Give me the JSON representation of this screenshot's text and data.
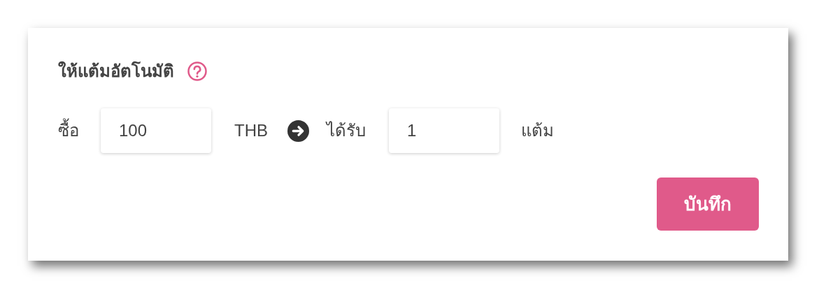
{
  "title": "ให้แต้มอัตโนมัติ",
  "rule": {
    "buy_label": "ซื้อ",
    "amount": "100",
    "currency": "THB",
    "receive_label": "ได้รับ",
    "points": "1",
    "points_unit": "แต้ม"
  },
  "save_button": "บันทึก"
}
